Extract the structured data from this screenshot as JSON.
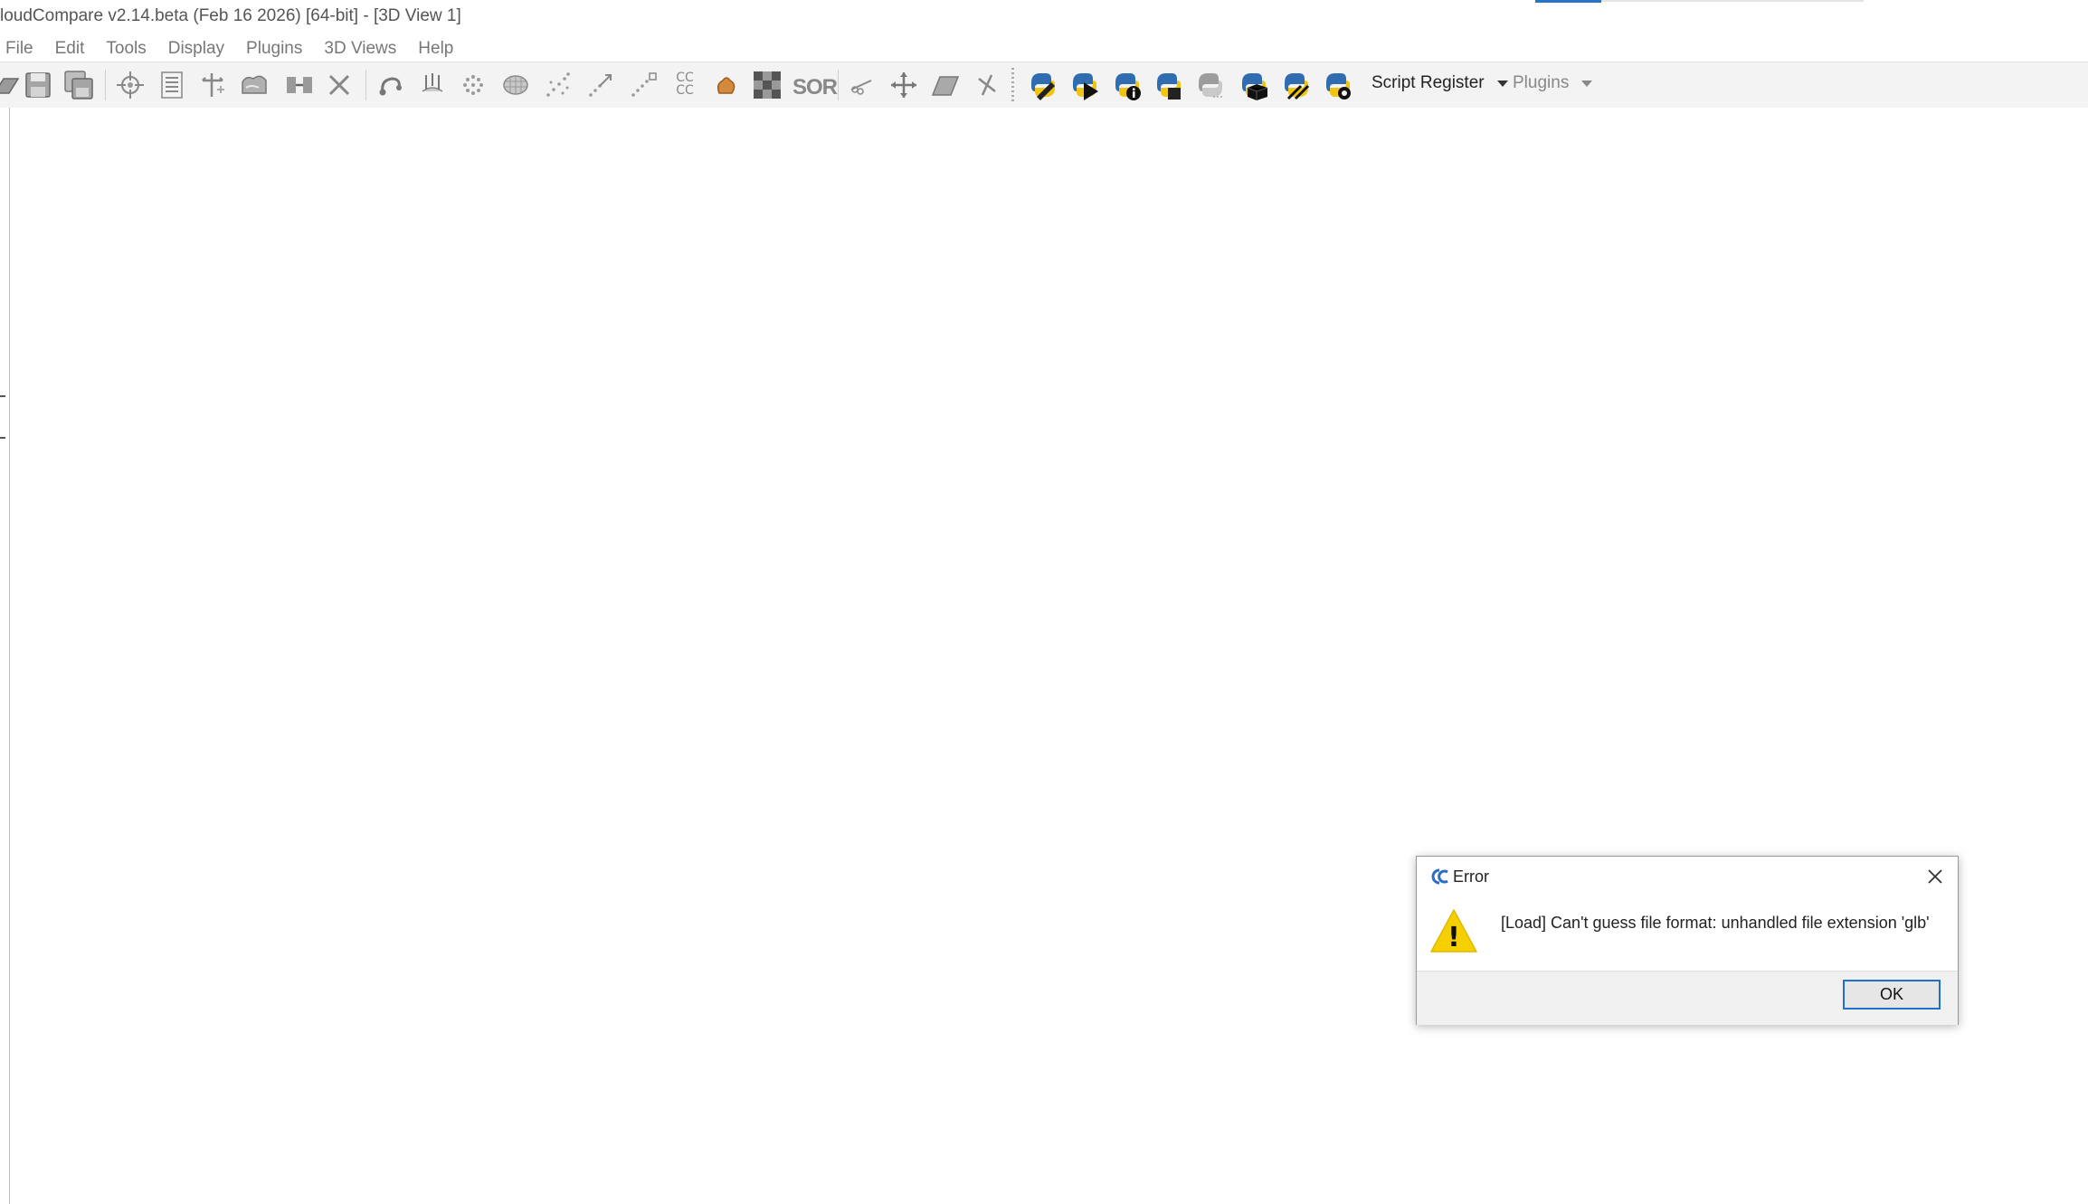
{
  "window": {
    "title": "loudCompare v2.14.beta (Feb 16 2026) [64-bit] - [3D View 1]"
  },
  "menu": [
    {
      "label": "File"
    },
    {
      "label": "Edit"
    },
    {
      "label": "Tools"
    },
    {
      "label": "Display"
    },
    {
      "label": "Plugins"
    },
    {
      "label": "3D Views"
    },
    {
      "label": "Help"
    }
  ],
  "toolbar": {
    "icons": [
      "open-icon",
      "save-icon",
      "save-all-icon",
      "point-picking-icon",
      "properties-list-icon",
      "translate-rotate-icon",
      "clone-icon",
      "merge-icon",
      "delete-icon",
      "sample-points-icon",
      "normals-icon",
      "density-icon",
      "mesh-icon",
      "noise-filter-icon",
      "register-icon",
      "align-icon",
      "connected-components-icon",
      "color-scale-icon",
      "raster-icon",
      "sor-filter-icon",
      "segment-icon",
      "move-icon",
      "plane-fit-icon",
      "cross-section-icon",
      "python-edit-icon",
      "python-run-icon",
      "python-info-icon",
      "python-package-icon",
      "python-repl-icon",
      "python-batch-icon",
      "python-jump-icon",
      "python-settings-icon"
    ],
    "sor_text": "SOR",
    "cc_text": "CC",
    "script_register": "Script Register",
    "plugins": "Plugins"
  },
  "dialog": {
    "title": "Error",
    "message": "[Load] Can't guess file format: unhandled file extension 'glb'",
    "ok_label": "OK",
    "warning_symbol": "!"
  },
  "colors": {
    "python_blue": "#2f6db0",
    "python_yellow": "#f1c40f",
    "focus_border": "#1e6fd0",
    "warning_yellow": "#f5d000"
  }
}
